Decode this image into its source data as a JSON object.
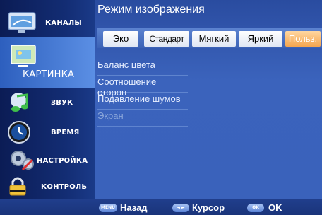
{
  "sidebar": {
    "items": [
      {
        "label": "КАНАЛЫ",
        "icon": "tv-icon"
      },
      {
        "label": "КАРТИНКА",
        "icon": "picture-icon"
      },
      {
        "label": "ЗВУК",
        "icon": "music-note-icon"
      },
      {
        "label": "ВРЕМЯ",
        "icon": "clock-icon"
      },
      {
        "label": "НАСТРОЙКА",
        "icon": "gear-icon"
      },
      {
        "label": "КОНТРОЛЬ",
        "icon": "lock-icon"
      }
    ]
  },
  "main": {
    "title": "Режим изображения",
    "modes": [
      "Эко",
      "Стандарт",
      "Мягкий",
      "Яркий",
      "Польз."
    ],
    "selected_mode": "Польз.",
    "menu": [
      {
        "label": "Баланс цвета"
      },
      {
        "label": "Соотношение сторон"
      },
      {
        "label": "Подавление шумов"
      },
      {
        "label": "Экран",
        "disabled": true
      }
    ]
  },
  "bottom": {
    "menu_key": "MENU",
    "back_label": "Назад",
    "cursor_key": "◄ ►",
    "cursor_label": "Курсор",
    "ok_key": "OK",
    "ok_label": "OK"
  },
  "colors": {
    "selected_mode": "#f4a54e",
    "active_sidebar": "#4a7fd6",
    "background": "#1b3a86"
  }
}
